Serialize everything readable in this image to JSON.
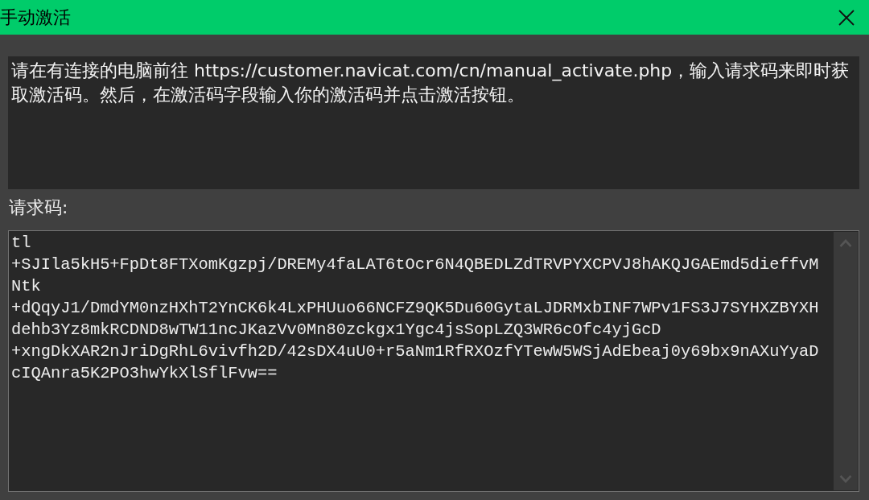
{
  "window": {
    "title": "手动激活"
  },
  "instructions": "请在有连接的电脑前往 https://customer.navicat.com/cn/manual_activate.php，输入请求码来即时获取激活码。然后，在激活码字段输入你的激活码并点击激活按钮。",
  "request_code": {
    "label": "请求码:",
    "value": "tl\n+SJIla5kH5+FpDt8FTXomKgzpj/DREMy4faLAT6tOcr6N4QBEDLZdTRVPYXCPVJ8hAKQJGAEmd5dieffvM\nNtk\n+dQqyJ1/DmdYM0nzHXhT2YnCK6k4LxPHUuo66NCFZ9QK5Du60GytaLJDRMxbINF7WPv1FS3J7SYHXZBYXH\ndehb3Yz8mkRCDND8wTW11ncJKazVv0Mn80zckgx1Ygc4jsSopLZQ3WR6cOfc4yjGcD\n+xngDkXAR2nJriDgRhL6vivfh2D/42sDX4uU0+r5aNm1RfRXOzfYTewW5WSjAdEbeaj0y69bx9nAXuYyaD\ncIQAnra5K2PO3hwYkXlSflFvw=="
  }
}
